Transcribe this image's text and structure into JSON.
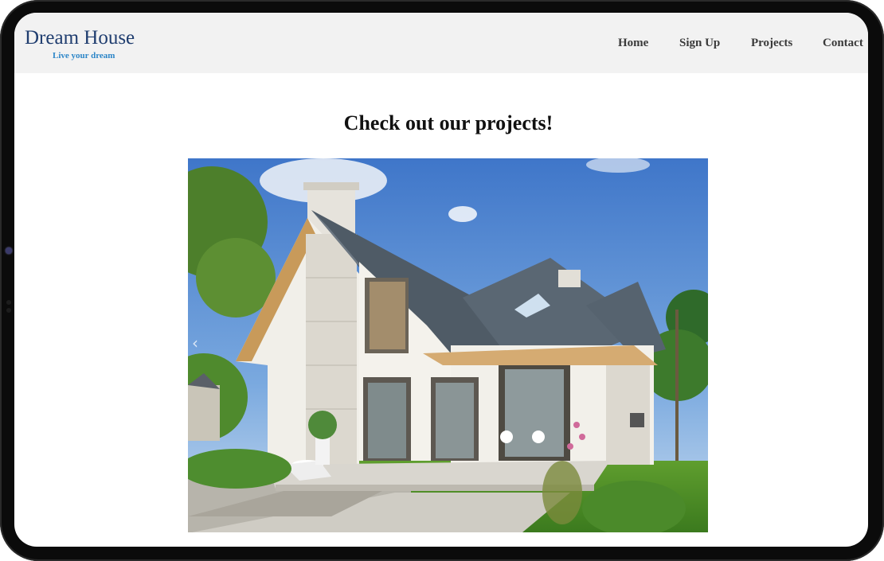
{
  "brand": {
    "title": "Dream House",
    "tagline": "Live your dream"
  },
  "nav": {
    "home": "Home",
    "signup": "Sign Up",
    "projects": "Projects",
    "contact": "Contact"
  },
  "main": {
    "heading": "Check out our projects!"
  },
  "carousel": {
    "prev_icon": "‹"
  },
  "colors": {
    "brand_title": "#1f3d6f",
    "brand_tagline": "#2d86c8",
    "header_bg": "#f2f2f2"
  }
}
